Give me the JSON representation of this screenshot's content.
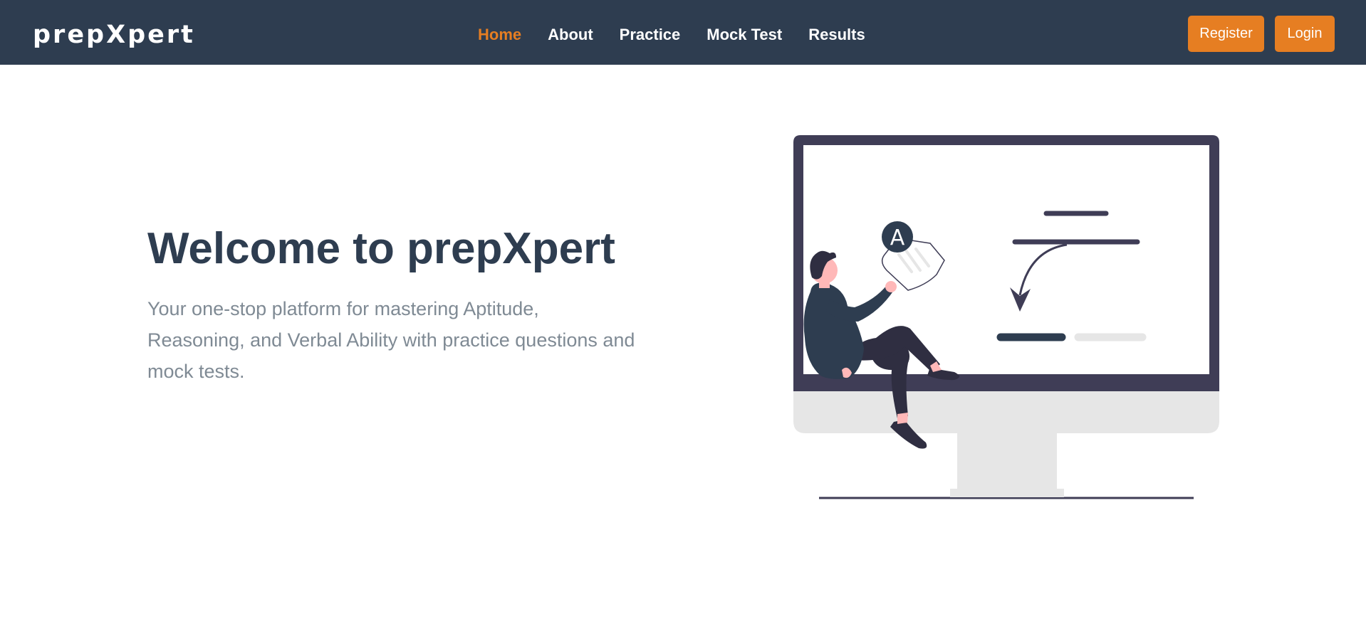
{
  "nav": {
    "brand": "prepXpert",
    "links": [
      {
        "label": "Home",
        "active": true
      },
      {
        "label": "About",
        "active": false
      },
      {
        "label": "Practice",
        "active": false
      },
      {
        "label": "Mock Test",
        "active": false
      },
      {
        "label": "Results",
        "active": false
      }
    ],
    "register_label": "Register",
    "login_label": "Login"
  },
  "hero": {
    "title": "Welcome to prepXpert",
    "subtitle": "Your one-stop platform for mastering Aptitude, Reasoning, and Verbal Ability with practice questions and mock tests.",
    "illustration": {
      "badge_letter": "A"
    }
  },
  "colors": {
    "navbar_bg": "#2e3d50",
    "accent": "#e67e22",
    "title": "#2e3d50",
    "subtitle": "#7f8a94",
    "monitor_frame": "#3f3d56",
    "monitor_stand": "#e6e6e6"
  }
}
